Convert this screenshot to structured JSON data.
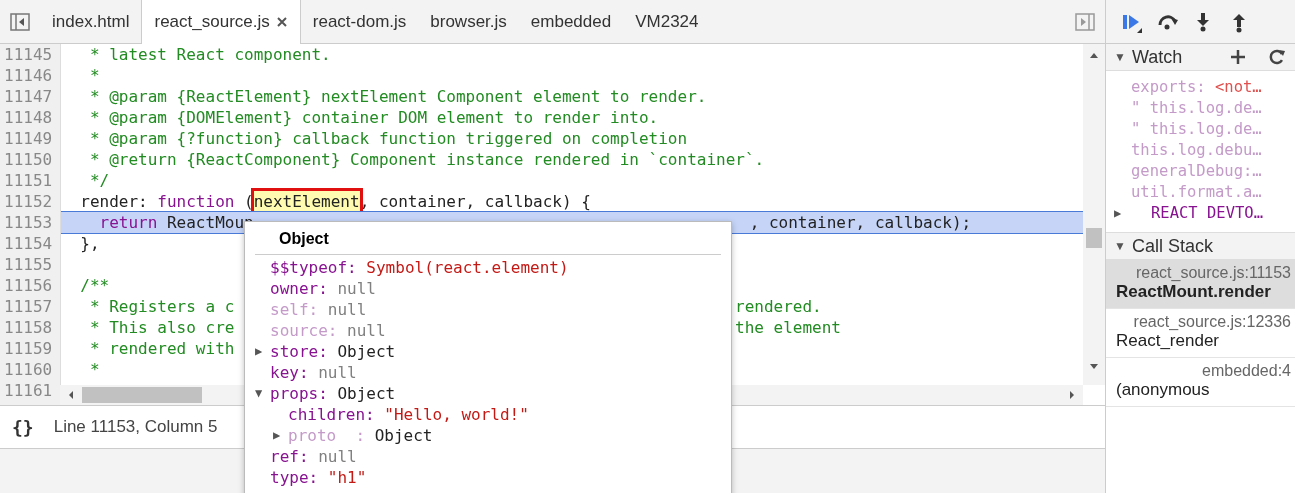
{
  "tabs": [
    {
      "label": "index.html",
      "selected": false,
      "closable": false
    },
    {
      "label": "react_source.js",
      "selected": true,
      "closable": true
    },
    {
      "label": "react-dom.js",
      "selected": false,
      "closable": false
    },
    {
      "label": "browser.js",
      "selected": false,
      "closable": false
    },
    {
      "label": "embedded",
      "selected": false,
      "closable": false
    },
    {
      "label": "VM2324",
      "selected": false,
      "closable": false
    }
  ],
  "code": {
    "lines": [
      {
        "number": "11145",
        "highlighted": false,
        "segments": [
          {
            "kind": "comment",
            "text": "   * latest React component."
          }
        ]
      },
      {
        "number": "11146",
        "highlighted": false,
        "segments": [
          {
            "kind": "comment",
            "text": "   *"
          }
        ]
      },
      {
        "number": "11147",
        "highlighted": false,
        "segments": [
          {
            "kind": "comment",
            "text": "   * @param {ReactElement} nextElement Component element to render."
          }
        ]
      },
      {
        "number": "11148",
        "highlighted": false,
        "segments": [
          {
            "kind": "comment",
            "text": "   * @param {DOMElement} container DOM element to render into."
          }
        ]
      },
      {
        "number": "11149",
        "highlighted": false,
        "segments": [
          {
            "kind": "comment",
            "text": "   * @param {?function} callback function triggered on completion"
          }
        ]
      },
      {
        "number": "11150",
        "highlighted": false,
        "segments": [
          {
            "kind": "comment",
            "text": "   * @return {ReactComponent} Component instance rendered in `container`."
          }
        ]
      },
      {
        "number": "11151",
        "highlighted": false,
        "segments": [
          {
            "kind": "comment",
            "text": "   */"
          }
        ]
      },
      {
        "number": "11152",
        "highlighted": false,
        "segments": [
          {
            "kind": "plain",
            "text": "  render: "
          },
          {
            "kind": "keyword",
            "text": "function"
          },
          {
            "kind": "plain",
            "text": " ("
          },
          {
            "kind": "inspected",
            "text": "nextElement"
          },
          {
            "kind": "plain",
            "text": ", container, callback) {"
          }
        ]
      },
      {
        "number": "11153",
        "highlighted": true,
        "segments": [
          {
            "kind": "keyword",
            "text": "    return"
          },
          {
            "kind": "plain",
            "text": " ReactMoun"
          }
        ],
        "tail": [
          {
            "kind": "plain",
            "text": ", container, callback);"
          }
        ]
      },
      {
        "number": "11154",
        "highlighted": false,
        "segments": [
          {
            "kind": "plain",
            "text": "  },"
          }
        ]
      },
      {
        "number": "11155",
        "highlighted": false
      },
      {
        "number": "11156",
        "highlighted": false,
        "segments": [
          {
            "kind": "comment",
            "text": "  /**"
          }
        ]
      },
      {
        "number": "11157",
        "highlighted": false,
        "segments": [
          {
            "kind": "comment",
            "text": "   * Registers a c"
          }
        ],
        "tail": [
          {
            "kind": "comment",
            "text": "rendered."
          }
        ]
      },
      {
        "number": "11158",
        "highlighted": false,
        "segments": [
          {
            "kind": "comment",
            "text": "   * This also cre"
          }
        ],
        "tail": [
          {
            "kind": "comment",
            "text": "the element"
          }
        ]
      },
      {
        "number": "11159",
        "highlighted": false,
        "segments": [
          {
            "kind": "comment",
            "text": "   * rendered with"
          }
        ]
      },
      {
        "number": "11160",
        "highlighted": false,
        "segments": [
          {
            "kind": "comment",
            "text": "   *"
          }
        ]
      },
      {
        "number": "11161",
        "highlighted": false
      }
    ]
  },
  "popover": {
    "title": "Object",
    "items": [
      {
        "key": "$$typeof:",
        "faded": false,
        "value": "Symbol(react.element)",
        "kind": "string"
      },
      {
        "key": "owner:",
        "faded": false,
        "value": "null",
        "kind": "null"
      },
      {
        "key": "self:",
        "faded": true,
        "value": "null",
        "kind": "null"
      },
      {
        "key": "source:",
        "faded": true,
        "value": "null",
        "kind": "null"
      },
      {
        "toggle": "▶",
        "key": "store:",
        "faded": false,
        "value": "Object",
        "kind": "object"
      },
      {
        "key": "key:",
        "faded": false,
        "value": "null",
        "kind": "null"
      },
      {
        "toggle": "▼",
        "key": "props:",
        "faded": false,
        "value": "Object",
        "kind": "object",
        "children": [
          {
            "key": "children:",
            "faded": false,
            "value": "\"Hello, world!\"",
            "kind": "string"
          },
          {
            "toggle": "▶",
            "key": "proto  :",
            "faded": true,
            "value": "Object",
            "kind": "object"
          }
        ]
      },
      {
        "key": "ref:",
        "faded": false,
        "value": "null",
        "kind": "null"
      },
      {
        "key": "type:",
        "faded": false,
        "value": "\"h1\"",
        "kind": "string"
      }
    ]
  },
  "status_bar": {
    "format_icon": "{}",
    "position": "Line 11153, Column 5"
  },
  "sidebar": {
    "watch": {
      "toggle": "▼",
      "title": "Watch",
      "items": [
        {
          "text": "exports: ",
          "value": "<not…"
        },
        {
          "text": "\" this.log.de…"
        },
        {
          "text": "\" this.log.de…"
        },
        {
          "text": "this.log.debu…"
        },
        {
          "text": "generalDebug:…"
        },
        {
          "text": "util.format.a…"
        },
        {
          "toggle": "▶",
          "text": "REACT DEVTO…"
        }
      ]
    },
    "call_stack": {
      "toggle": "▼",
      "title": "Call Stack",
      "frames": [
        {
          "location": "react_source.js:11153",
          "name": "ReactMount.render",
          "selected": true
        },
        {
          "location": "react_source.js:12336",
          "name": "React_render",
          "selected": false
        },
        {
          "location": "embedded:4",
          "name": "(anonymous",
          "selected": false
        }
      ]
    }
  }
}
